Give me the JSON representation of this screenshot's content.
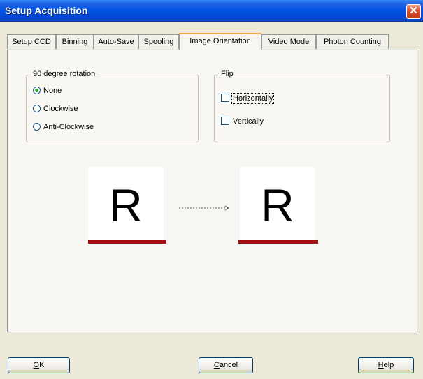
{
  "window": {
    "title": "Setup Acquisition",
    "close_glyph": "✕"
  },
  "tabs": [
    {
      "label": "Setup CCD"
    },
    {
      "label": "Binning"
    },
    {
      "label": "Auto-Save"
    },
    {
      "label": "Spooling"
    },
    {
      "label": "Image Orientation",
      "active": true
    },
    {
      "label": "Video Mode"
    },
    {
      "label": "Photon Counting"
    }
  ],
  "rotation": {
    "legend": "90 degree rotation",
    "selected": "None",
    "options": [
      {
        "label": "None"
      },
      {
        "label": "Clockwise"
      },
      {
        "label": "Anti-Clockwise"
      }
    ]
  },
  "flip": {
    "legend": "Flip",
    "options": [
      {
        "label": "Horizontally",
        "checked": false
      },
      {
        "label": "Vertically",
        "checked": false
      }
    ]
  },
  "preview": {
    "before_letter": "R",
    "after_letter": "R",
    "bar_color": "#a01010"
  },
  "buttons": {
    "ok": {
      "mnemonic": "O",
      "rest": "K"
    },
    "cancel": {
      "mnemonic": "C",
      "rest": "ancel"
    },
    "help": {
      "mnemonic": "H",
      "rest": "elp"
    }
  },
  "colors": {
    "titlebar": "#0054e3",
    "dialog_bg": "#ece9d8",
    "panel_bg": "#f8f7f3",
    "active_tab_accent": "#f5a93f"
  },
  "icons": {
    "close": "close-icon",
    "arrow": "arrow-right-icon"
  }
}
